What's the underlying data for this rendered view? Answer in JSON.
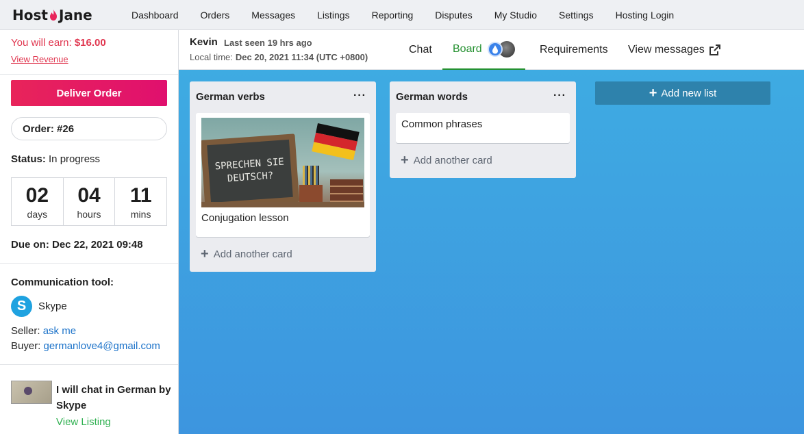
{
  "brand": {
    "logo_left": "Host",
    "logo_right": "Jane"
  },
  "nav": {
    "items": [
      "Dashboard",
      "Orders",
      "Messages",
      "Listings",
      "Reporting",
      "Disputes",
      "My Studio",
      "Settings",
      "Hosting Login"
    ]
  },
  "sidebar": {
    "earn_label": "You will earn: ",
    "earn_amount": "$16.00",
    "view_revenue": "View Revenue",
    "deliver_button": "Deliver Order",
    "order_label": "Order: #26",
    "status_label": "Status:",
    "status_value": " In progress",
    "timer": {
      "days_value": "02",
      "days_label": "days",
      "hours_value": "04",
      "hours_label": "hours",
      "mins_value": "11",
      "mins_label": "mins"
    },
    "due_on": "Due on: Dec 22, 2021 09:48",
    "comm_title": "Communication tool:",
    "comm_tool": "Skype",
    "seller_label": "Seller: ",
    "seller_value": "ask me",
    "buyer_label": "Buyer: ",
    "buyer_value": "germanlove4@gmail.com",
    "listing_title": "I will chat in German by Skype",
    "view_listing": "View Listing"
  },
  "header": {
    "buyer_name": "Kevin",
    "last_seen": "Last seen 19 hrs ago",
    "local_time_label": "Local time:",
    "local_time_value": "Dec 20, 2021 11:34 (UTC +0800)",
    "tabs": {
      "chat": "Chat",
      "board": "Board",
      "requirements": "Requirements",
      "view_messages": "View messages"
    }
  },
  "board": {
    "lists": [
      {
        "title": "German verbs",
        "cards": [
          {
            "text": "Conjugation lesson",
            "image_text_line1": "SPRECHEN SIE",
            "image_text_line2": "DEUTSCH?"
          }
        ],
        "add_card": "Add another card"
      },
      {
        "title": "German words",
        "cards": [
          {
            "text": "Common phrases"
          }
        ],
        "add_card": "Add another card"
      }
    ],
    "add_list": "Add new list"
  },
  "colors": {
    "accent_pink": "#e8245a",
    "earn_red": "#e0364f",
    "active_tab_green": "#23902f",
    "board_blue": "#3eabe2",
    "add_list_blue": "#2e82ac",
    "link_blue": "#1b72c9",
    "listing_green": "#2fb050"
  },
  "icons": [
    "flame-icon",
    "drop-icon",
    "external-link-icon",
    "skype-icon",
    "more-icon",
    "plus-icon"
  ]
}
